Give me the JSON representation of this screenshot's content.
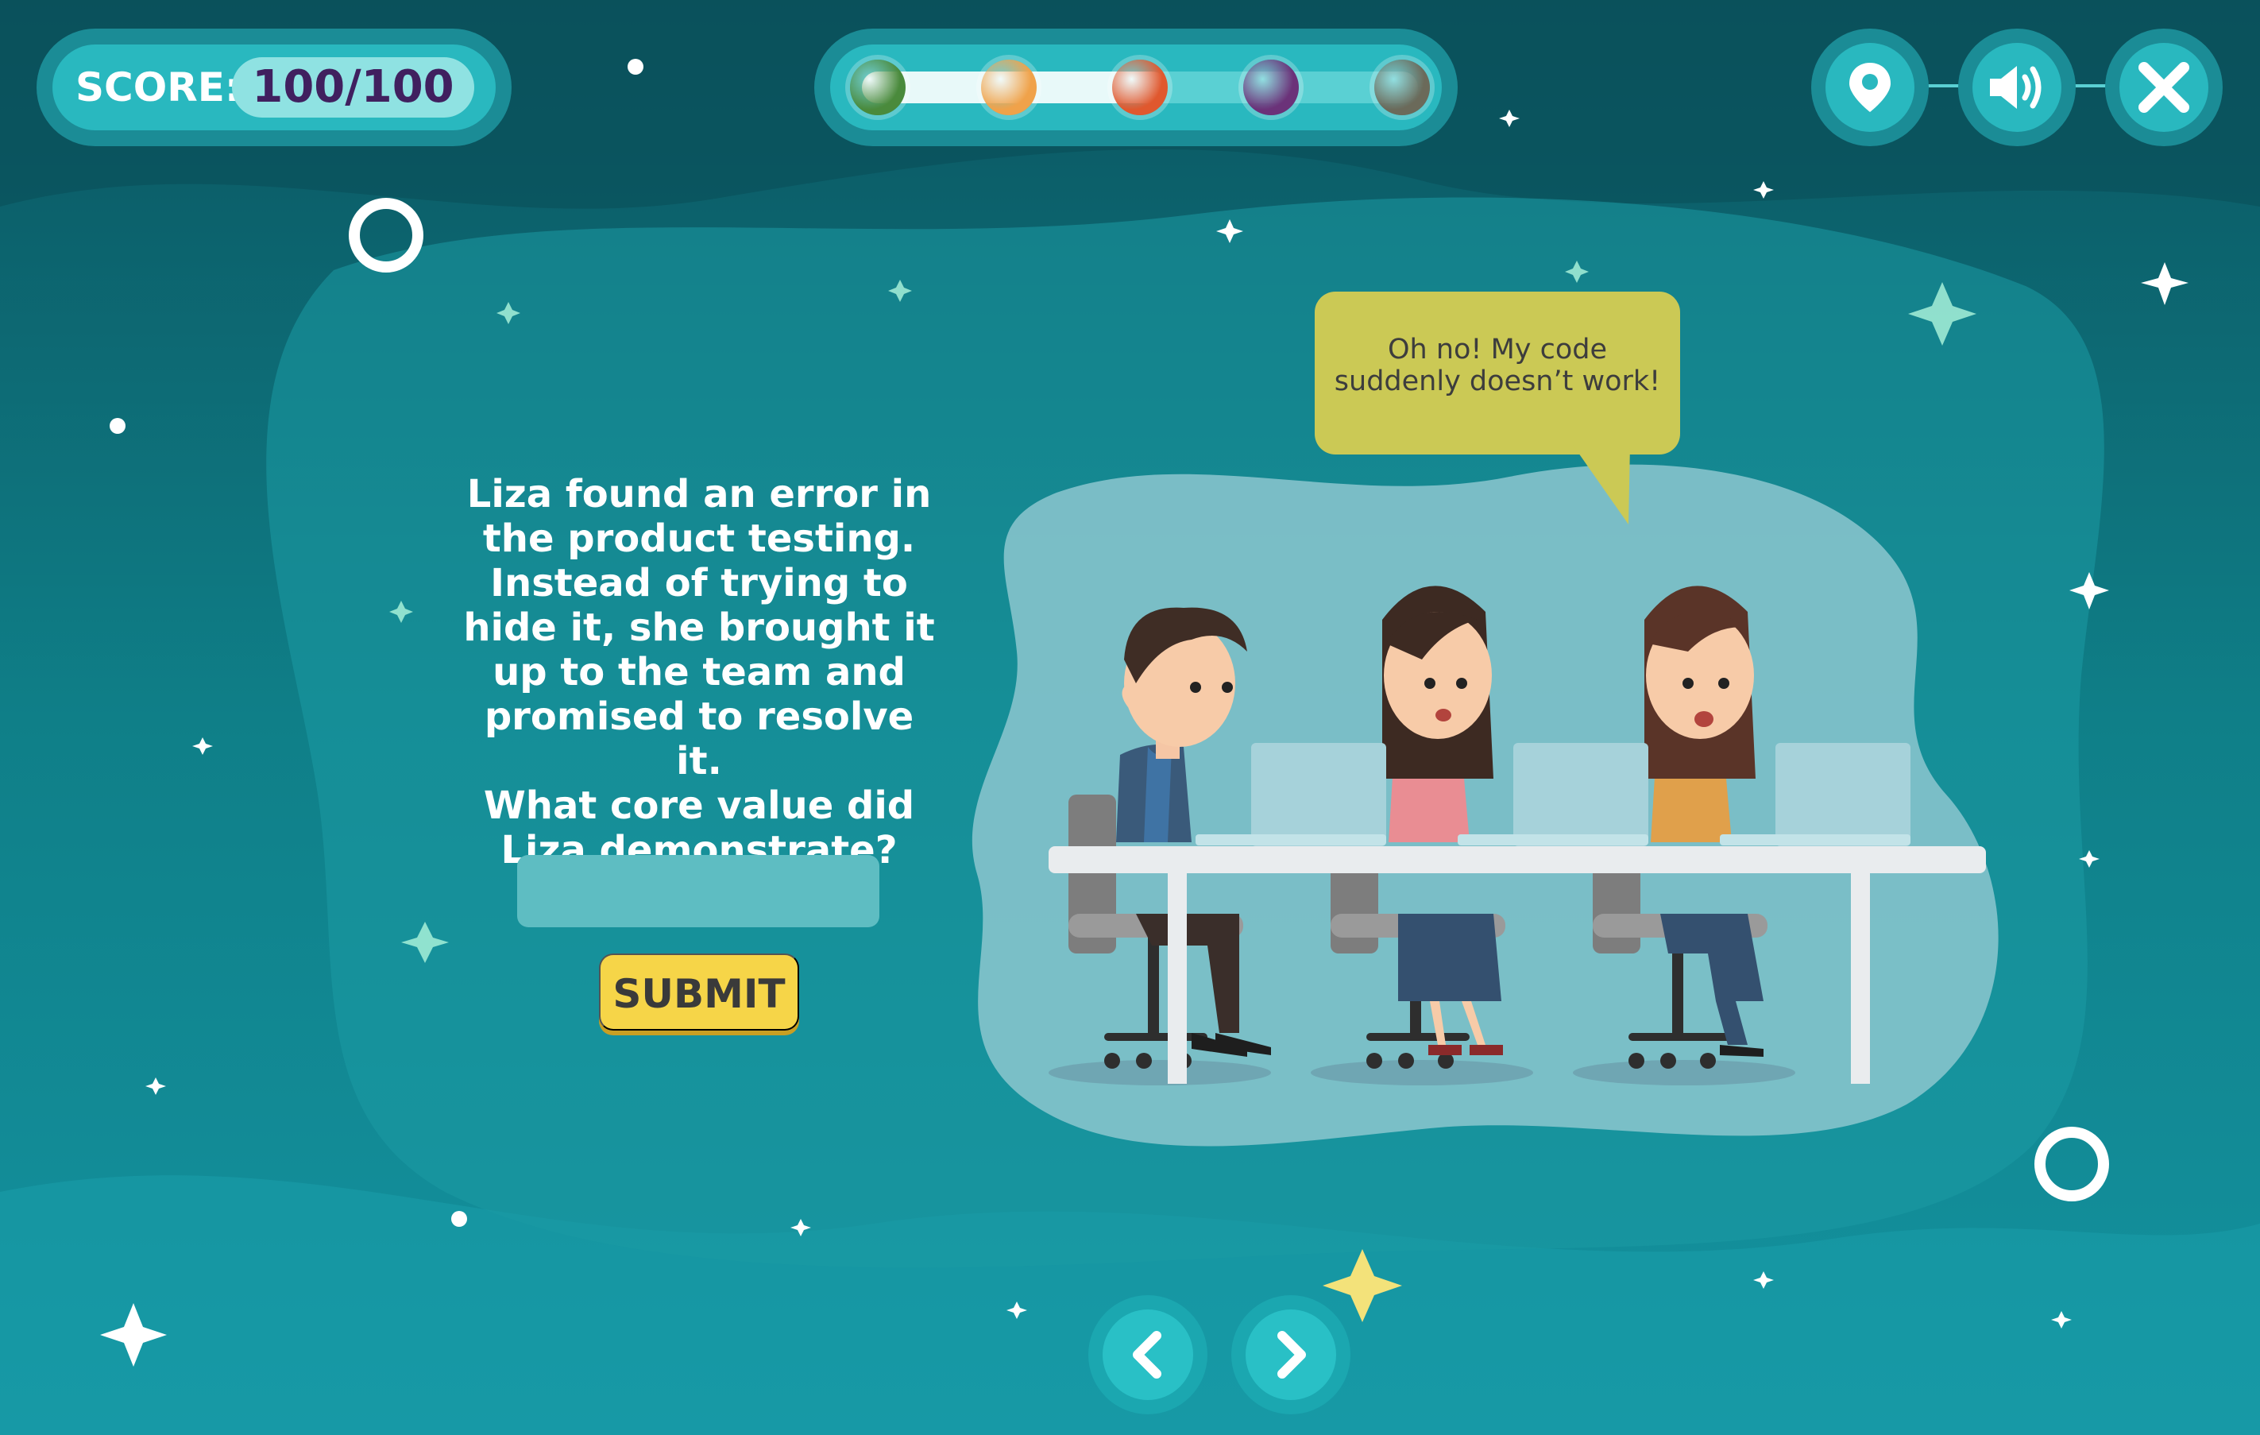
{
  "hud": {
    "score_label": "SCORE:",
    "score_value": "100/100"
  },
  "progress": {
    "fraction_complete": 0.55,
    "planets": [
      {
        "name": "green-planet",
        "color": "#4a8a3c"
      },
      {
        "name": "ringed-orange-planet",
        "color": "#f0a24a"
      },
      {
        "name": "red-striped-planet",
        "color": "#e0582e"
      },
      {
        "name": "purple-planet",
        "color": "#6b3279"
      },
      {
        "name": "gray-planet",
        "color": "#6b6a5a"
      }
    ]
  },
  "controls": {
    "map_icon": "map-pin-icon",
    "sound_icon": "speaker-icon",
    "close_icon": "close-icon",
    "prev_icon": "chevron-left-icon",
    "next_icon": "chevron-right-icon"
  },
  "question": {
    "lines": [
      "Liza found an error in",
      "the product testing.",
      "Instead of trying to",
      "hide it, she brought it",
      "up to the team and",
      "promised to resolve it.",
      "What core value did",
      "Liza demonstrate?"
    ],
    "answer_value": "",
    "submit_label": "SUBMIT"
  },
  "scene": {
    "speech_line1": "Oh no! My code",
    "speech_line2": "suddenly doesn’t work!"
  },
  "colors": {
    "bg_dark": "#0d5f6a",
    "bg_mid": "#138e98",
    "accent_yellow": "#f6d548",
    "score_text": "#40205f"
  }
}
